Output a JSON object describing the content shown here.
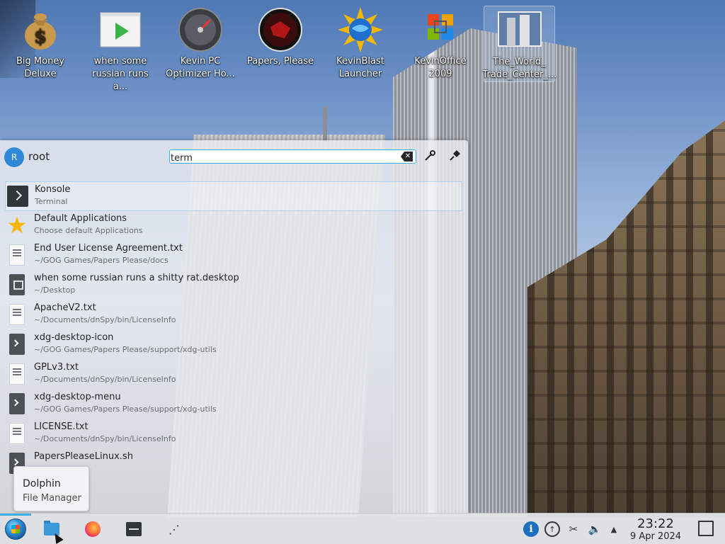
{
  "desktop": {
    "icons": [
      {
        "label": "Big Money\nDeluxe",
        "icon": "money-bag-icon"
      },
      {
        "label": "when some\nrussian runs a...",
        "icon": "video-file-icon"
      },
      {
        "label": "Kevin PC\nOptimizer Ho...",
        "icon": "gauge-icon"
      },
      {
        "label": "Papers, Please",
        "icon": "papers-please-icon"
      },
      {
        "label": "KevinBlast\nLauncher",
        "icon": "globe-sun-icon"
      },
      {
        "label": "KevinOffice\n2009",
        "icon": "office-icon"
      },
      {
        "label": "The_World_\nTrade_Center_...",
        "icon": "image-file-icon"
      }
    ]
  },
  "launcher": {
    "user_initial": "R",
    "username": "root",
    "search_value": "term",
    "results": [
      {
        "title": "Konsole",
        "subtitle": "Terminal",
        "icon": "terminal-icon"
      },
      {
        "title": "Default Applications",
        "subtitle": "Choose default Applications",
        "icon": "star-icon"
      },
      {
        "title": "End User License Agreement.txt",
        "subtitle": "~/GOG Games/Papers Please/docs",
        "icon": "text-file-icon"
      },
      {
        "title": "when some russian runs a shitty rat.desktop",
        "subtitle": "~/Desktop",
        "icon": "desktop-file-icon"
      },
      {
        "title": "ApacheV2.txt",
        "subtitle": "~/Documents/dnSpy/bin/LicenseInfo",
        "icon": "text-file-icon"
      },
      {
        "title": "xdg-desktop-icon",
        "subtitle": "~/GOG Games/Papers Please/support/xdg-utils",
        "icon": "script-icon"
      },
      {
        "title": "GPLv3.txt",
        "subtitle": "~/Documents/dnSpy/bin/LicenseInfo",
        "icon": "text-file-icon"
      },
      {
        "title": "xdg-desktop-menu",
        "subtitle": "~/GOG Games/Papers Please/support/xdg-utils",
        "icon": "script-icon"
      },
      {
        "title": "LICENSE.txt",
        "subtitle": "~/Documents/dnSpy/bin/LicenseInfo",
        "icon": "text-file-icon"
      },
      {
        "title": "PapersPleaseLinux.sh",
        "subtitle": "",
        "icon": "script-icon"
      }
    ]
  },
  "tooltip": {
    "title": "Dolphin",
    "subtitle": "File Manager"
  },
  "taskbar": {
    "clock_time": "23:22",
    "clock_date": "9 Apr 2024"
  },
  "colors": {
    "accent": "#3daee9"
  }
}
